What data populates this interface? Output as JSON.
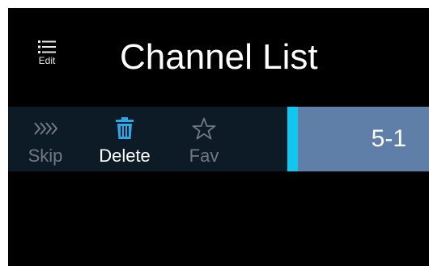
{
  "header": {
    "edit_label": "Edit",
    "title": "Channel List"
  },
  "toolbar": {
    "skip_label": "Skip",
    "delete_label": "Delete",
    "fav_label": "Fav"
  },
  "channel_list": {
    "items": [
      {
        "number": "5-1",
        "focused": true
      }
    ]
  },
  "colors": {
    "background": "#000000",
    "toolbar_bg": "#0c1b26",
    "selected_item_bg": "#5f7fa8",
    "focus_accent": "#11c6f0",
    "delete_icon": "#2aa8e8",
    "inactive_text": "#6f7a82"
  },
  "icons": {
    "edit": "list-icon",
    "skip": "skip-arrows-icon",
    "delete": "trash-icon",
    "fav": "star-icon"
  }
}
